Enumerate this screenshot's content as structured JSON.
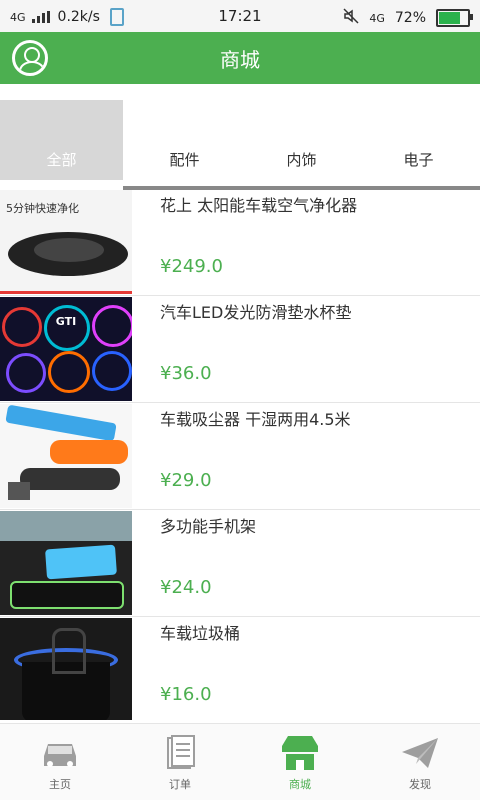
{
  "status_bar": {
    "network": "4G",
    "speed": "0.2k/s",
    "time": "17:21",
    "network_right": "4G",
    "battery": "72%",
    "colors": {
      "battery_fill": "#2bb24c"
    }
  },
  "header": {
    "title": "商城",
    "avatar_icon": "user-icon",
    "accent": "#4caf50"
  },
  "tabs": [
    {
      "label": "全部",
      "active": true
    },
    {
      "label": "配件",
      "active": false
    },
    {
      "label": "内饰",
      "active": false
    },
    {
      "label": "电子",
      "active": false
    }
  ],
  "products": [
    {
      "title": "花上 太阳能车载空气净化器",
      "price": "¥249.0",
      "thumb_text": "5分钟快速净化"
    },
    {
      "title": "汽车LED发光防滑垫水杯垫",
      "price": "¥36.0",
      "thumb_text": "GTI"
    },
    {
      "title": "车载吸尘器 干湿两用4.5米",
      "price": "¥29.0",
      "thumb_text": ""
    },
    {
      "title": "多功能手机架",
      "price": "¥24.0",
      "thumb_text": ""
    },
    {
      "title": "车载垃圾桶",
      "price": "¥16.0",
      "thumb_text": ""
    }
  ],
  "bottom_nav": [
    {
      "label": "主页",
      "icon": "car-icon",
      "active": false
    },
    {
      "label": "订单",
      "icon": "orders-icon",
      "active": false
    },
    {
      "label": "商城",
      "icon": "store-icon",
      "active": true
    },
    {
      "label": "发现",
      "icon": "paper-plane-icon",
      "active": false
    }
  ]
}
